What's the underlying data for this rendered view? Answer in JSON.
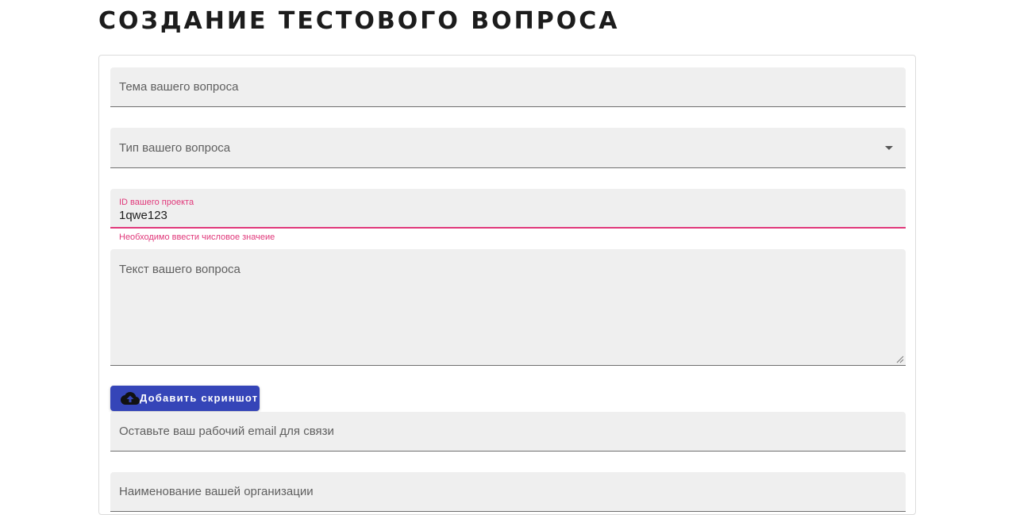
{
  "page": {
    "title": "СОЗДАНИЕ ТЕСТОВОГО ВОПРОСА"
  },
  "form": {
    "topic": {
      "placeholder": "Тема вашего вопроса"
    },
    "type": {
      "placeholder": "Тип вашего вопроса",
      "icon": "dropdown-arrow-icon"
    },
    "project_id": {
      "label": "ID вашего проекта",
      "value": "1qwe123",
      "error": "Необходимо ввести числовое значеие"
    },
    "question_text": {
      "placeholder": "Текст вашего вопроса",
      "icon": "resize-handle-icon"
    },
    "upload_button": {
      "label": "Добавить скриншот",
      "icon": "cloud-upload-icon"
    },
    "email": {
      "placeholder": "Оставьте ваш рабочий email для связи"
    },
    "organization": {
      "placeholder": "Наименование вашей организации"
    }
  },
  "colors": {
    "accent_error": "#e0387a",
    "button_primary": "#3545b8",
    "field_background": "#efefef",
    "title_text": "#1c1c1c"
  }
}
